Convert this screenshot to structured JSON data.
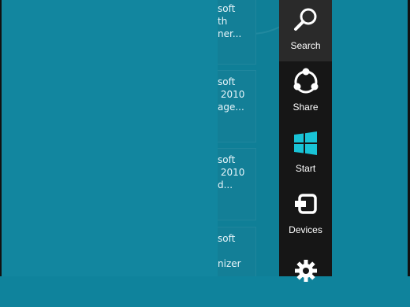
{
  "tiles": [
    {
      "text": "soft\nth\nner..."
    },
    {
      "text": "soft\n 2010\nage..."
    },
    {
      "text": "soft\n 2010\nd..."
    },
    {
      "text": "soft\n\nnizer"
    }
  ],
  "charms": [
    {
      "label": "Search",
      "icon": "search-icon"
    },
    {
      "label": "Share",
      "icon": "share-icon"
    },
    {
      "label": "Start",
      "icon": "windows-start-icon",
      "color": "#19c3d6"
    },
    {
      "label": "Devices",
      "icon": "devices-icon"
    },
    {
      "label": "",
      "icon": "settings-icon"
    }
  ],
  "colors": {
    "background": "#0f839c",
    "charms_bar": "#161616",
    "start_icon": "#19c3d6"
  }
}
